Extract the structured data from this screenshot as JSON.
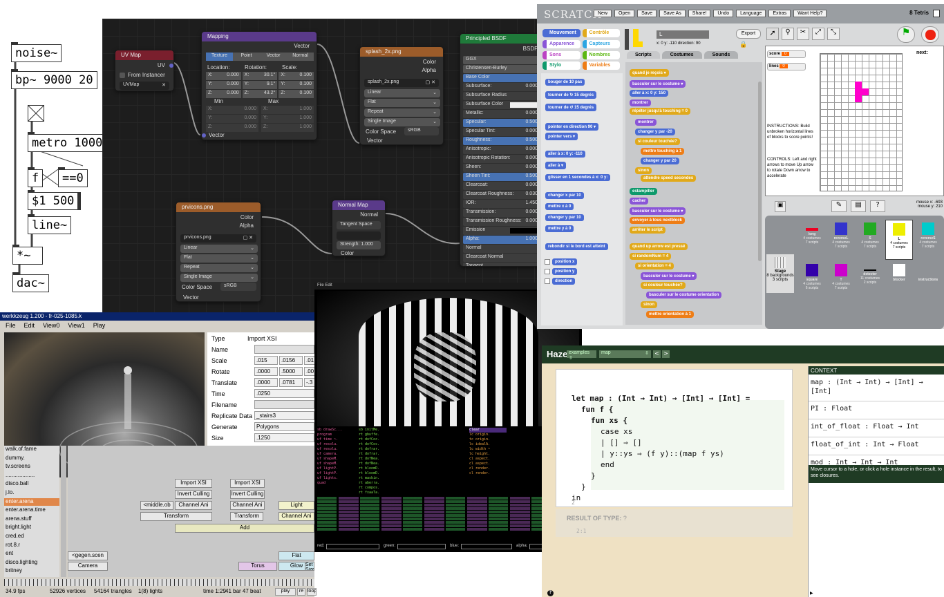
{
  "pd": {
    "noise": "noise~",
    "bp": "bp~ 9000 20",
    "metro": "metro 1000",
    "f": "f",
    "eq": "==0",
    "msg": "$1 500",
    "line": "line~",
    "mul": "*~",
    "dac": "dac~"
  },
  "blender": {
    "uvmap": {
      "title": "UV Map",
      "socket": "UV",
      "from_instancer": "From Instancer",
      "value": "UVMap"
    },
    "mapping": {
      "title": "Mapping",
      "socket_vector": "Vector",
      "tabs": [
        "Texture",
        "Point",
        "Vector",
        "Normal"
      ],
      "location": "Location:",
      "rotation": "Rotation:",
      "scale": "Scale:",
      "rows": [
        [
          "X:",
          "0.000",
          "X:",
          "30.1°",
          "X:",
          "0.100"
        ],
        [
          "Y:",
          "0.000",
          "Y:",
          "9.1°",
          "Y:",
          "0.100"
        ],
        [
          "Z:",
          "0.000",
          "Z:",
          "43.2°",
          "Z:",
          "0.100"
        ]
      ],
      "min": "Min",
      "max": "Max",
      "minrows": [
        [
          "X:",
          "0.000",
          "X:",
          "1.000"
        ],
        [
          "Y:",
          "0.000",
          "Y:",
          "1.000"
        ],
        [
          "Z:",
          "0.000",
          "Z:",
          "1.000"
        ]
      ],
      "vector_in": "Vector"
    },
    "splash": {
      "title": "splash_2x.png",
      "color": "Color",
      "alpha": "Alpha",
      "file": "splash_2x.png",
      "opts": [
        "Linear",
        "Flat",
        "Repeat",
        "Single Image"
      ],
      "cs_label": "Color Space",
      "cs": "sRGB",
      "vector": "Vector"
    },
    "bsdf": {
      "title": "Principled BSDF",
      "bsdf": "BSDF",
      "rows": [
        "GGX",
        "Christensen-Burley",
        "Base Color",
        "Subsurface:",
        "Subsurface Radius",
        "Subsurface Color",
        "Metallic:",
        "Specular:",
        "Specular Tint:",
        "Roughness:",
        "Anisotropic:",
        "Anisotropic Rotation:",
        "Sheen:",
        "Sheen Tint:",
        "Clearcoat:",
        "Clearcoat Roughness:",
        "IOR:",
        "Transmission:",
        "Transmission Roughness:",
        "Emission",
        "Alpha:",
        "Normal",
        "Clearcoat Normal",
        "Tangent"
      ],
      "vals": [
        "",
        "",
        "",
        "0.000",
        "",
        "",
        "0.000",
        "0.500",
        "0.000",
        "0.500",
        "0.000",
        "0.000",
        "0.000",
        "0.500",
        "0.000",
        "0.030",
        "1.450",
        "0.000",
        "0.000",
        "",
        "1.000",
        "",
        "",
        ""
      ]
    },
    "prvicons": {
      "title": "prvicons.png",
      "color": "Color",
      "alpha": "Alpha",
      "file": "prvicons.png",
      "opts": [
        "Linear",
        "Flat",
        "Repeat",
        "Single Image"
      ],
      "cs_label": "Color Space",
      "cs": "sRGB",
      "vector": "Vector"
    },
    "normalmap": {
      "title": "Normal Map",
      "normal": "Normal",
      "space": "Tangent Space",
      "strength": "Strength:",
      "strength_val": "1.000",
      "color": "Color"
    }
  },
  "werk": {
    "title": "werkkzeug 1.200 - fr-025-1085.k",
    "menu": [
      "File",
      "Edit",
      "View0",
      "View1",
      "Play"
    ],
    "props": [
      [
        "Type",
        "Import XSI"
      ],
      [
        "Name",
        ""
      ],
      [
        "Scale",
        ".015",
        ".0156",
        ".01"
      ],
      [
        "Rotate",
        ".0000",
        ".5000",
        ".00"
      ],
      [
        "Translate",
        ".0000",
        ".0781",
        "-.3"
      ],
      [
        "Time",
        ".0250"
      ],
      [
        "Filename",
        ""
      ],
      [
        "Replicate Data Fr",
        "_stairs3"
      ],
      [
        "Generate",
        "Polygons"
      ],
      [
        "Size",
        ".1250"
      ]
    ],
    "list": [
      "walk.of.fame",
      "dummy.",
      "tv.screens",
      "...................",
      "disco.ball",
      "j.lo.",
      "enter.arena",
      "enter.arena.time",
      "arena.stuff",
      "bright.light",
      "cred.ed",
      "rot.8.r",
      "ent",
      "disco.lighting",
      "britney"
    ],
    "ops": [
      "Import XSI",
      "Invert Culling",
      "Channel Ani",
      "Transform",
      "Import XSI",
      "Invert Culling",
      "Channel Ani",
      "<middle.ob",
      "Transform",
      "Light",
      "Channel Ani",
      "Add",
      "<gegen.scen",
      "Camera",
      "Flat",
      "Torus",
      "Glow",
      "Set Size"
    ],
    "status": [
      "34.9 fps",
      "52926 vertices",
      "54164 triangles",
      "1(8) lights",
      "time 1:29",
      "41 bar 47 beat",
      "play",
      "re",
      "loop"
    ]
  },
  "vj": {
    "menu": [
      "File",
      "Edit"
    ],
    "fields": [
      "red:",
      "green:",
      "blue:",
      "alpha:"
    ],
    "cols": [
      [
        "sb drawSc...",
        "program",
        "uf time ~.",
        "uf resolu.",
        "uf resolu.",
        "uf camera.",
        "uf shapeM.",
        "uf shapeM.",
        "uf lightP.",
        "uf lightP.",
        "uf lights.",
        "quad"
      ],
      [
        "sb initMe.",
        "rt gbuffe.",
        "rt dofCoc.",
        "rt dofCoc.",
        "rt dofrar.",
        "rt dofrar.",
        "rt dofNea.",
        "rt dofNea.",
        "rt bloomD.",
        "rt bloomD.",
        "rt maskin.",
        "rt aberra.",
        "rt compos.",
        "rt fxaaTa."
      ],
      [
        "clear",
        "lc origin.",
        "tc origin.",
        "lc idealA.",
        "lc width ~",
        "lc height.",
        "cl aspect.",
        "cl aspect.",
        "cl render.",
        "cl render."
      ]
    ]
  },
  "scratch": {
    "logo": "SCRATCH",
    "buttons": [
      "New",
      "Open",
      "Save",
      "Save As",
      "Share!",
      "Undo",
      "Language",
      "Extras",
      "Want Help?"
    ],
    "project": "8 Tetris",
    "cats": [
      "Mouvement",
      "Contrôle",
      "Apparence",
      "Capteurs",
      "Sons",
      "Nombres",
      "Stylo",
      "Variables"
    ],
    "sprite": "L",
    "coords": "x: 0    y: -110  direction: 90",
    "export": "Export",
    "tabs": [
      "Scripts",
      "Costumes",
      "Sounds"
    ],
    "palette": [
      "bouger de 10 pas",
      "tourner de ↻ 15 degrés",
      "tourner de ↺ 15 degrés",
      "pointer en direction 90 ▾",
      "pointer vers ▾",
      "aller à x: 0 y: -110",
      "aller à ▾",
      "glisser en 1 secondes à x: 0 y:",
      "changer x par 10",
      "mettre x à 0",
      "changer y par 10",
      "mettre y à 0",
      "rebondir si le bord est atteint",
      "position x",
      "position y",
      "direction"
    ],
    "scripts": [
      "quand je reçois ▾",
      "basculer sur le costume ▾",
      "aller à x: 0 y: 150",
      "montrer",
      "répéter jusqu'à touching = 0",
      "montrer",
      "changer y par -20",
      "si couleur touchée?",
      "mettre touching à 1",
      "changer y par 20",
      "sinon",
      "attendre speed secondes",
      "estampiller",
      "cacher",
      "basculer sur le costume ▾",
      "envoyer à tous nextblock",
      "arrêter le script",
      "quand up arrow est pressé",
      "si randomNum = 4",
      "si orientation = 4",
      "basculer sur le costume ▾",
      "si couleur touchée?",
      "basculer sur le costume orientation",
      "sinon",
      "mettre orientation à 1"
    ],
    "score": "score",
    "score_val": "0",
    "lines": "lines",
    "lines_val": "0",
    "next": "next:",
    "instructions": "INSTRUCTIONS: Build unbroken horizontal lines of blocks to score points!",
    "controls": "CONTROLS: Left and right arrows to move Up arrow to rotate Down arrow to accelerate",
    "mouse": [
      "mouse x: -693",
      "mouse y: 210"
    ],
    "sprites": [
      [
        "long",
        "4 costumes",
        "7 scripts"
      ],
      [
        "reverseL",
        "4 costumes",
        "7 scripts"
      ],
      [
        "S",
        "4 costumes",
        "7 scripts"
      ],
      [
        "L",
        "4 costumes",
        "7 scripts"
      ],
      [
        "reverseS",
        "4 costumes",
        "7 scripts"
      ],
      [
        "square",
        "4 costumes",
        "6 scripts"
      ],
      [
        "T",
        "4 costumes",
        "7 scripts"
      ],
      [
        "detecter",
        "11 costumes",
        "2 scripts"
      ],
      [
        "blocker",
        "",
        ""
      ],
      [
        "instructions",
        "",
        ""
      ]
    ],
    "stage": [
      "Stage",
      "8 backgrounds",
      "3 scripts"
    ]
  },
  "hazel": {
    "logo": "Hazel",
    "example": "examples",
    "selector": "map",
    "prev": "<",
    "next": ">",
    "code": [
      "let map : (Int → Int) → [Int] → [Int] =",
      "fun f {",
      "fun xs {",
      "case xs",
      "| [] ⇒ []",
      "| y::ys ⇒ (f y)::(map f ys)",
      "end",
      "}",
      "}",
      "in"
    ],
    "hole": "2",
    "result_label": "RESULT OF TYPE:",
    "result_type": "?",
    "result_val": "2:1",
    "context": "CONTEXT",
    "ctx": [
      "map : (Int → Int) → [Int] → [Int]",
      "PI : Float",
      "int_of_float : Float → Int",
      "float_of_int : Int → Float",
      "mod : Int → Int → Int"
    ],
    "hint": "Move cursor to a hole, or click a hole instance in the result, to see closures."
  }
}
